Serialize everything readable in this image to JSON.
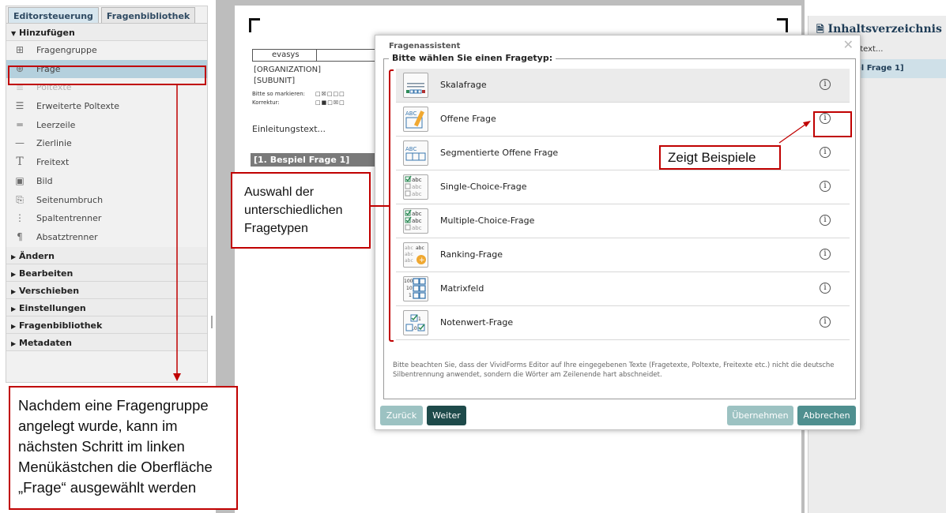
{
  "sidebar": {
    "tabs": [
      {
        "label": "Editorsteuerung"
      },
      {
        "label": "Fragenbibliothek"
      }
    ],
    "open_section": "Hinzufügen",
    "items": [
      {
        "label": "Fragengruppe",
        "icon": "add-group-icon",
        "glyph": "⊞"
      },
      {
        "label": "Frage",
        "icon": "add-question-icon",
        "glyph": "⊕"
      },
      {
        "label": "Poltexte",
        "icon": "poltext-icon",
        "glyph": "≣"
      },
      {
        "label": "Erweiterte Poltexte",
        "icon": "extended-poltext-icon",
        "glyph": "☰"
      },
      {
        "label": "Leerzeile",
        "icon": "blank-line-icon",
        "glyph": "═"
      },
      {
        "label": "Zierlinie",
        "icon": "decorative-line-icon",
        "glyph": "—"
      },
      {
        "label": "Freitext",
        "icon": "text-icon",
        "glyph": "T"
      },
      {
        "label": "Bild",
        "icon": "image-icon",
        "glyph": "▣"
      },
      {
        "label": "Seitenumbruch",
        "icon": "page-break-icon",
        "glyph": "⎘"
      },
      {
        "label": "Spaltentrenner",
        "icon": "column-divider-icon",
        "glyph": "⋮"
      },
      {
        "label": "Absatztrenner",
        "icon": "paragraph-icon",
        "glyph": "¶"
      }
    ],
    "sections": [
      "Ändern",
      "Bearbeiten",
      "Verschieben",
      "Einstellungen",
      "Fragenbibliothek",
      "Metadaten"
    ]
  },
  "document": {
    "header_label": "evasys",
    "organization": "[ORGANIZATION]",
    "subunit": "[SUBUNIT]",
    "mark_hint": "Bitte so markieren:",
    "correction_hint": "Korrektur:",
    "intro_text": "Einleitungstext...",
    "question_header": "[1. Bespiel Frage 1]"
  },
  "right_pane": {
    "title": "Inhaltsverzeichnis",
    "item_1": "stext...",
    "item_2": "el Frage 1]"
  },
  "modal": {
    "title": "Fragenassistent",
    "legend": "Bitte wählen Sie einen Fragetyp:",
    "question_types": [
      {
        "label": "Skalafrage",
        "icon": "scale-question-icon"
      },
      {
        "label": "Offene Frage",
        "icon": "open-question-icon"
      },
      {
        "label": "Segmentierte Offene Frage",
        "icon": "segmented-open-question-icon"
      },
      {
        "label": "Single-Choice-Frage",
        "icon": "single-choice-icon"
      },
      {
        "label": "Multiple-Choice-Frage",
        "icon": "multiple-choice-icon"
      },
      {
        "label": "Ranking-Frage",
        "icon": "ranking-icon"
      },
      {
        "label": "Matrixfeld",
        "icon": "matrix-icon"
      },
      {
        "label": "Notenwert-Frage",
        "icon": "grade-value-icon"
      }
    ],
    "info_glyph": "i",
    "note": "Bitte beachten Sie, dass der VividForms Editor auf Ihre eingegebenen Texte (Fragetexte, Poltexte, Freitexte etc.) nicht die deutsche Silbentrennung anwendet, sondern die Wörter am Zeilenende hart abschneidet.",
    "buttons": {
      "back": "Zurück",
      "next": "Weiter",
      "apply": "Übernehmen",
      "cancel": "Abbrechen"
    }
  },
  "annotations": {
    "types_note": "Auswahl der unterschiedlichen Fragetypen",
    "examples_note": "Zeigt Beispiele",
    "bottom_note": "Nachdem eine Fragengruppe angelegt wurde, kann im nächsten Schritt im linken Menükästchen die Oberfläche „Frage“ ausgewählt werden"
  },
  "colors": {
    "annotation_red": "#c00000",
    "sidebar_selected": "#b4d0dd",
    "primary_button": "#1e4a4a",
    "secondary_button": "#9cc2c2",
    "cancel_button": "#4f8f8f"
  }
}
